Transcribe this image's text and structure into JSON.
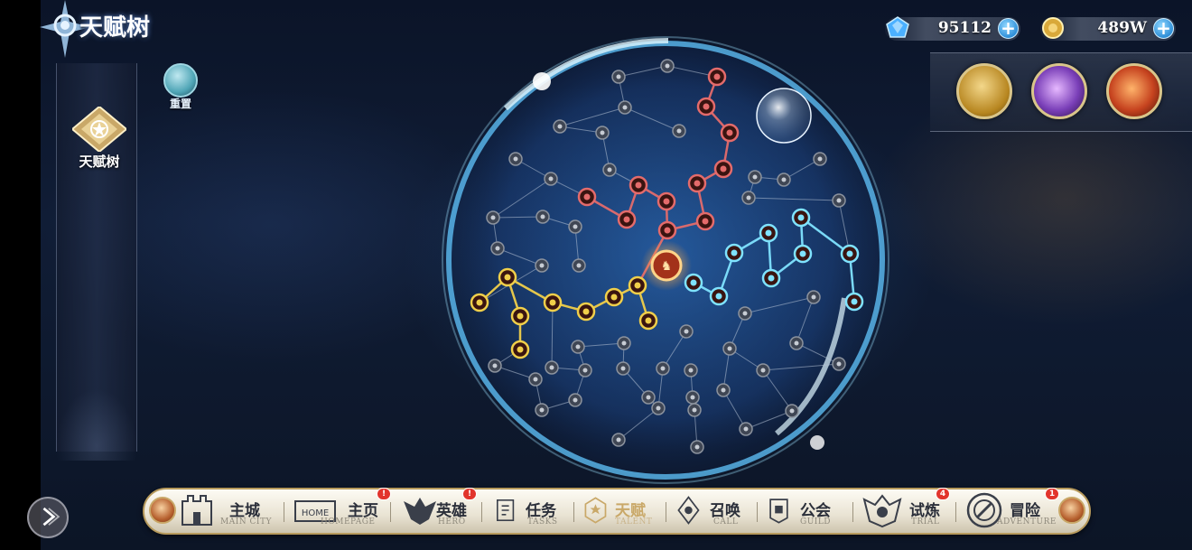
{
  "header": {
    "title": "天赋树"
  },
  "sidebar": {
    "talent_tab_label": "天赋树",
    "reset_label": "重置"
  },
  "currency": {
    "gems": {
      "icon": "blue-gem-icon",
      "amount": "95112"
    },
    "gold": {
      "icon": "gold-coin-icon",
      "amount": "489W"
    }
  },
  "skills": [
    {
      "name": "skill-golden-tree",
      "color": "#c89a3a"
    },
    {
      "name": "skill-purple-skull",
      "color": "#7a3fb8"
    },
    {
      "name": "skill-fire-slash",
      "color": "#c6431f"
    }
  ],
  "nav": {
    "items": [
      {
        "id": "main-city",
        "label": "主城",
        "sub": "MAIN CITY",
        "badge": ""
      },
      {
        "id": "homepage",
        "label": "主页",
        "sub": "HOMEPAGE",
        "badge": "!"
      },
      {
        "id": "hero",
        "label": "英雄",
        "sub": "HERO",
        "badge": "!"
      },
      {
        "id": "tasks",
        "label": "任务",
        "sub": "TASKS",
        "badge": ""
      },
      {
        "id": "talent",
        "label": "天赋",
        "sub": "TALENT",
        "badge": ""
      },
      {
        "id": "call",
        "label": "召唤",
        "sub": "CALL",
        "badge": ""
      },
      {
        "id": "guild",
        "label": "公会",
        "sub": "GUILD",
        "badge": ""
      },
      {
        "id": "trial",
        "label": "试炼",
        "sub": "TRIAL",
        "badge": "4"
      },
      {
        "id": "adventure",
        "label": "冒险",
        "sub": "ADVENTURE",
        "badge": "1"
      }
    ],
    "homepage_icon_text": "HOME"
  },
  "colors": {
    "path_red": "#e46b6b",
    "path_gold": "#f0cf4a",
    "path_cyan": "#7fe3ff",
    "node_grey": "#8c939e",
    "accent_gold": "#c9a868"
  }
}
